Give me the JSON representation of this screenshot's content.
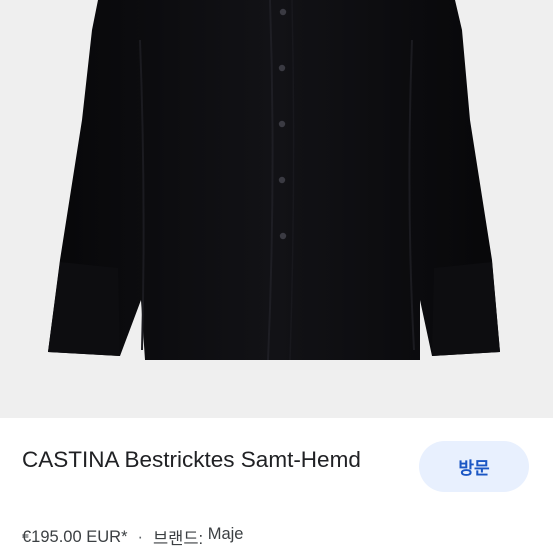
{
  "product": {
    "title": "CASTINA Bestricktes Samt-Hemd",
    "price": "€195.00 EUR*",
    "separator": "·",
    "brand_label": "브랜드:",
    "brand": "Maje"
  },
  "actions": {
    "visit_label": "방문"
  },
  "colors": {
    "image_bg": "#efefef",
    "garment": "#0a0a0c",
    "visit_bg": "#e8f0fe",
    "visit_text": "#1a56c4"
  },
  "icons": {
    "product_image": "black-velvet-shirt-photo"
  }
}
